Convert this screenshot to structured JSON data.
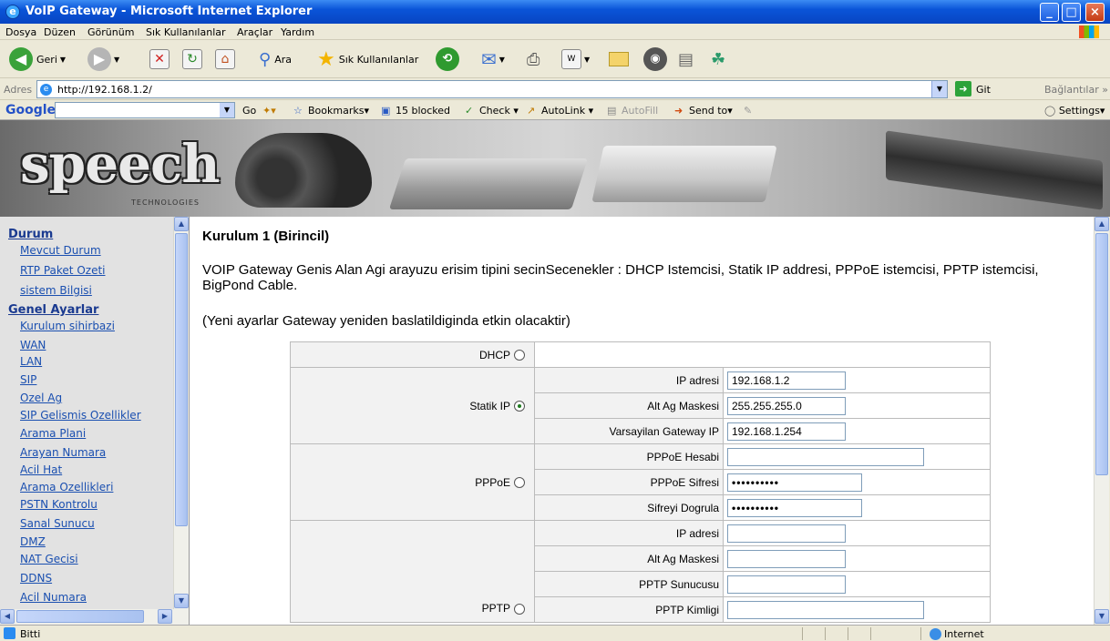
{
  "window": {
    "title": "VoIP Gateway - Microsoft Internet Explorer",
    "minimize": "_",
    "maximize": "□",
    "close": "×"
  },
  "menu": [
    "Dosya",
    "Düzen",
    "Görünüm",
    "Sık Kullanılanlar",
    "Araçlar",
    "Yardım"
  ],
  "toolbar": {
    "back": "Geri",
    "search": "Ara",
    "favorites": "Sık Kullanılanlar"
  },
  "address": {
    "label": "Adres",
    "url": "http://192.168.1.2/",
    "go": "Git",
    "links": "Bağlantılar »"
  },
  "google": {
    "logo": "Google",
    "go": "Go",
    "bookmarks": "Bookmarks▾",
    "blocked": "15 blocked",
    "check": "Check ▾",
    "autolink": "AutoLink ▾",
    "autofill": "AutoFill",
    "sendto": "Send to▾",
    "settings": "Settings▾"
  },
  "banner": {
    "brand": "speech",
    "sub": "TECHNOLOGIES"
  },
  "sidebar": {
    "sections": [
      "Durum",
      "Genel Ayarlar"
    ],
    "status_items": [
      "Mevcut Durum",
      "RTP Paket Ozeti",
      "sistem Bilgisi"
    ],
    "general_items": [
      "Kurulum sihirbazi",
      "WAN",
      "LAN",
      "SIP",
      "Ozel Ag",
      "SIP Gelismis Ozellikler",
      "Arama Plani",
      "Arayan Numara",
      "Acil Hat",
      "Arama Ozellikleri",
      "PSTN Kontrolu",
      "Sanal Sunucu",
      "DMZ",
      "NAT Gecisi",
      "DDNS",
      "Acil Numara"
    ]
  },
  "page": {
    "title": "Kurulum 1 (Birincil)",
    "description": "VOIP Gateway Genis Alan Agi arayuzu erisim tipini secinSecenekler : DHCP Istemcisi, Statik IP addresi, PPPoE istemcisi, PPTP istemcisi, BigPond Cable.",
    "note": "(Yeni ayarlar Gateway yeniden baslatildiginda etkin olacaktir)"
  },
  "form": {
    "dhcp": "DHCP",
    "static": {
      "label": "Statik IP",
      "selected": true,
      "ip_label": "IP adresi",
      "ip": "192.168.1.2",
      "mask_label": "Alt Ag Maskesi",
      "mask": "255.255.255.0",
      "gw_label": "Varsayilan Gateway IP",
      "gw": "192.168.1.254"
    },
    "pppoe": {
      "label": "PPPoE",
      "account_label": "PPPoE Hesabi",
      "password_label": "PPPoE Sifresi",
      "password": "••••••••••",
      "confirm_label": "Sifreyi Dogrula",
      "confirm": "••••••••••"
    },
    "pptp": {
      "label": "PPTP",
      "ip_label": "IP adresi",
      "mask_label": "Alt Ag Maskesi",
      "server_label": "PPTP Sunucusu",
      "id_label": "PPTP Kimligi"
    }
  },
  "status": {
    "text": "Bitti",
    "zone": "Internet"
  }
}
